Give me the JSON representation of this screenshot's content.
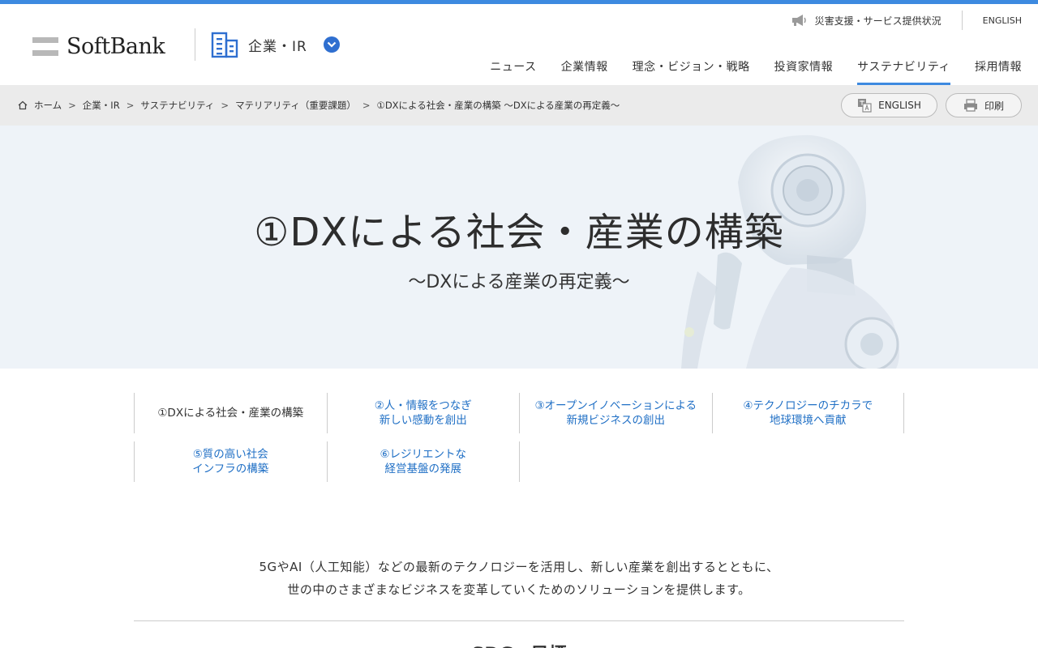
{
  "header": {
    "logo_text": "SoftBank",
    "section_label": "企業・IR",
    "utility": {
      "disaster": "災害支援・サービス提供状況",
      "english": "ENGLISH"
    },
    "nav": [
      "ニュース",
      "企業情報",
      "理念・ビジョン・戦略",
      "投資家情報",
      "サステナビリティ",
      "採用情報"
    ],
    "active_nav": "サステナビリティ"
  },
  "breadcrumb": {
    "items": [
      "ホーム",
      "企業・IR",
      "サステナビリティ",
      "マテリアリティ（重要課題）",
      "①DXによる社会・産業の構築 ～DXによる産業の再定義～"
    ],
    "separator": ">",
    "english_button": "ENGLISH",
    "print_button": "印刷"
  },
  "hero": {
    "title": "①DXによる社会・産業の構築",
    "subtitle": "～DXによる産業の再定義～"
  },
  "tabs": [
    [
      "①DXによる社会・産業の構築"
    ],
    [
      "②人・情報をつなぎ",
      "新しい感動を創出"
    ],
    [
      "③オープンイノベーションによる",
      "新規ビジネスの創出"
    ],
    [
      "④テクノロジーのチカラで",
      "地球環境へ貢献"
    ],
    [
      "⑤質の高い社会",
      "インフラの構築"
    ],
    [
      "⑥レジリエントな",
      "経営基盤の発展"
    ]
  ],
  "intro": {
    "line1": "5GやAI（人工知能）などの最新のテクノロジーを活用し、新しい産業を創出するとともに、",
    "line2": "世の中のさまざまなビジネスを変革していくためのソリューションを提供します。"
  },
  "next_heading": "SDGs 目標",
  "colors": {
    "accent": "#3d8ae0",
    "link": "#1f6fc5",
    "crumb_bg": "#ebebeb",
    "hero_bg": "#eef3f8"
  }
}
